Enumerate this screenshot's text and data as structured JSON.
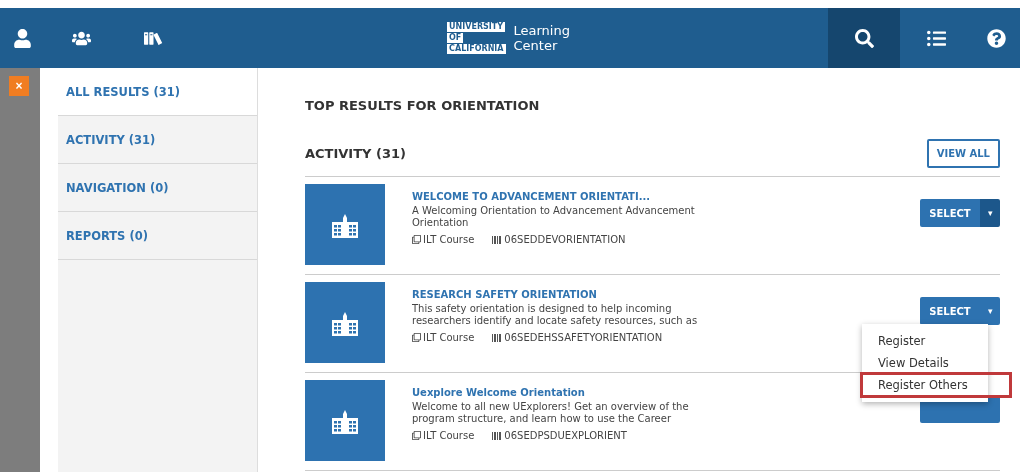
{
  "header": {
    "logo": {
      "lines": [
        "UNIVERSITY",
        "OF",
        "CALIFORNIA"
      ],
      "title_lines": [
        "Learning",
        "Center"
      ]
    },
    "left_icons": [
      {
        "kind": "user",
        "selected": false
      },
      {
        "kind": "users",
        "selected": false
      },
      {
        "kind": "books",
        "selected": false
      }
    ],
    "right_icons": [
      {
        "kind": "search",
        "selected": true
      },
      {
        "kind": "list",
        "selected": false
      },
      {
        "kind": "help",
        "selected": false
      }
    ]
  },
  "close_button": {
    "label": "×"
  },
  "sidebar": {
    "items": [
      {
        "label": "ALL RESULTS (31)",
        "selected": true
      },
      {
        "label": "ACTIVITY (31)",
        "selected": false
      },
      {
        "label": "NAVIGATION (0)",
        "selected": false
      },
      {
        "label": "REPORTS (0)",
        "selected": false
      }
    ]
  },
  "main": {
    "title": "TOP RESULTS FOR ORIENTATION",
    "section": {
      "title": "ACTIVITY (31)",
      "view_all": "VIEW ALL"
    },
    "items": [
      {
        "title": "WELCOME TO ADVANCEMENT ORIENTATI...",
        "description": "A Welcoming Orientation to Advancement Advancement Orientation",
        "type": "ILT Course",
        "code": "06SEDDEVORIENTATION",
        "select": "SELECT",
        "caret": "▾",
        "menu_open": false
      },
      {
        "title": "RESEARCH SAFETY ORIENTATION",
        "description": "This safety orientation is designed to help incoming researchers identify and locate safety resources, such as",
        "type": "ILT Course",
        "code": "06SEDEHSSAFETYORIENTATION",
        "select": "SELECT",
        "caret": "▾",
        "menu_open": true
      },
      {
        "title": "Uexplore Welcome Orientation",
        "description": "Welcome to all new UExplorers! Get an overview of the program structure, and learn how to use the Career",
        "type": "ILT Course",
        "code": "06SEDPSDUEXPLORIENT",
        "menu_open": false
      }
    ],
    "menu": {
      "items": [
        {
          "label": "Register",
          "highlighted": false
        },
        {
          "label": "View Details",
          "highlighted": false
        },
        {
          "label": "Register Others",
          "highlighted": true
        }
      ]
    }
  }
}
